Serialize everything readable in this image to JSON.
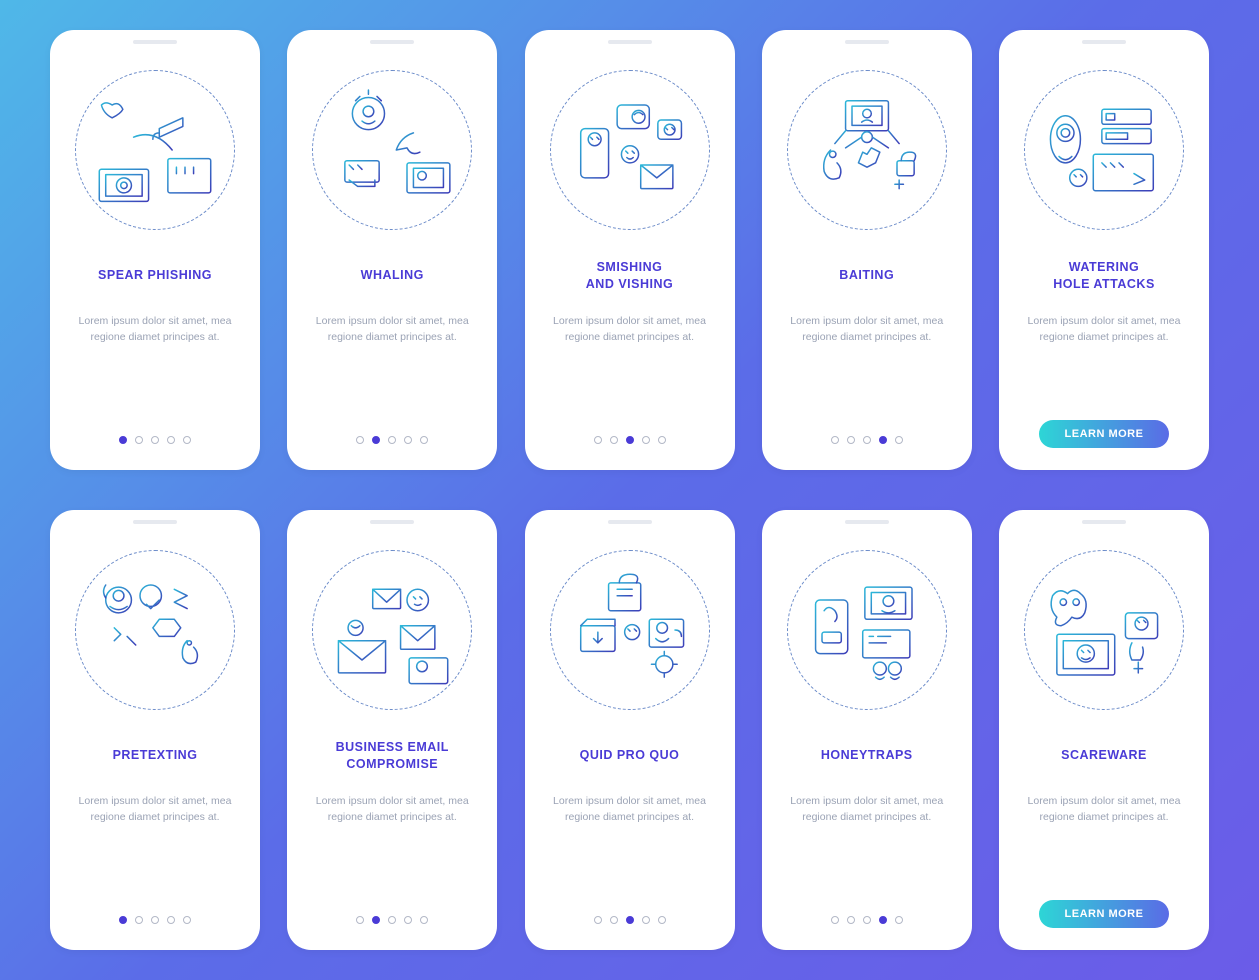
{
  "button_label": "LEARN MORE",
  "desc": "Lorem ipsum dolor sit amet, mea regione diamet principes at.",
  "cards": [
    {
      "title": "SPEAR PHISHING",
      "active": 0,
      "dots": 5,
      "icon": "spear"
    },
    {
      "title": "WHALING",
      "active": 1,
      "dots": 5,
      "icon": "whaling"
    },
    {
      "title": "SMISHING\nAND VISHING",
      "active": 2,
      "dots": 5,
      "icon": "smishing"
    },
    {
      "title": "BAITING",
      "active": 3,
      "dots": 5,
      "icon": "baiting"
    },
    {
      "title": "WATERING\nHOLE ATTACKS",
      "button": true,
      "icon": "watering"
    },
    {
      "title": "PRETEXTING",
      "active": 0,
      "dots": 5,
      "icon": "pretexting"
    },
    {
      "title": "BUSINESS EMAIL\nCOMPROMISE",
      "active": 1,
      "dots": 5,
      "icon": "bec"
    },
    {
      "title": "QUID PRO QUO",
      "active": 2,
      "dots": 5,
      "icon": "quid"
    },
    {
      "title": "HONEYTRAPS",
      "active": 3,
      "dots": 5,
      "icon": "honey"
    },
    {
      "title": "SCAREWARE",
      "button": true,
      "icon": "scare"
    }
  ],
  "icons": {
    "spear": "<rect x='18' y='78' width='46' height='30' rx='2'/><rect x='24' y='83' width='34' height='20'/><circle cx='41' cy='93' r='7'/><circle cx='41' cy='93' r='3'/><path d='M30 18 Q24 14 20 18 Q22 26 30 30 Q38 26 40 22 Q36 14 30 18'/><path d='M96 30 L74 40 L74 48 L96 38 Z M74 44 Q68 44 68 50'/><rect x='82' y='68' width='40' height='32' rx='2'/><path d='M90 76 L90 82 M98 76 L98 82 M106 76 L106 82'/><path d='M50 48 Q70 40 86 60'/>",
    "whaling": "<circle cx='48' cy='26' r='15'/><circle cx='48' cy='24' r='5'/><path d='M42 33 Q48 38 54 33'/><path d='M36 14 L40 10 M60 14 L56 10 M48 8 L48 4'/><path d='M90 44 Q78 48 74 60 L84 58 Q88 66 96 62'/><rect x='84' y='72' width='40' height='28' rx='2'/><rect x='90' y='77' width='28' height='18'/><circle cx='98' cy='84' r='4'/><rect x='26' y='70' width='32' height='20' rx='2'/><path d='M30 74 L34 78 M38 74 L42 78'/><path d='M30 88 L38 94 L54 94 L54 88'/>",
    "smishing": "<rect x='24' y='40' width='26' height='46' rx='4'/><circle cx='37' cy='50' r='6'/><path d='M33 48 L35 50 M39 48 L41 50'/><rect x='58' y='18' width='30' height='22' rx='4'/><circle cx='78' cy='29' r='6'/><path d='M74 27 Q78 23 82 27'/><rect x='96' y='32' width='22' height='18' rx='3'/><circle cx='107' cy='41' r='5'/><path d='M103 39 L105 41 M109 39 L111 41'/><rect x='80' y='74' width='30' height='22' rx='1'/><path d='M80 74 L95 86 L110 74'/><circle cx='70' cy='64' r='8'/><path d='M66 61 L68 63 M72 61 L74 63 M67 67 Q70 70 73 67'/>",
    "baiting": "<rect x='50' y='14' width='40' height='28' rx='2'/><rect x='56' y='19' width='28' height='18'/><circle cx='70' cy='26' r='4'/><path d='M65 34 Q70 30 75 34'/><path d='M50 42 L40 54 M90 42 L100 54'/><circle cx='70' cy='48' r='5'/><path d='M65 48 L50 58 M75 48 L90 58'/><path d='M36 60 Q28 68 30 80 Q34 90 44 86 Q48 78 42 72'/><circle cx='38' cy='64' r='3'/><path d='M70 64 L74 58 L82 62 L78 72 L70 76 L62 72 L66 62 Z'/><rect x='98' y='70' width='16' height='14' rx='2'/><path d='M102 70 Q102 62 110 62 Q118 62 114 70'/><path d='M96 92 L104 92 M100 88 L100 96'/>",
    "watering": "<ellipse cx='34' cy='50' rx='14' ry='22'/><circle cx='34' cy='44' r='8'/><circle cx='34' cy='44' r='4'/><path d='M28 66 Q34 72 40 66'/><rect x='68' y='22' width='46' height='14' rx='2'/><rect x='72' y='26' width='8' height='6'/><rect x='68' y='40' width='46' height='14' rx='2'/><rect x='72' y='44' width='20' height='6'/><rect x='60' y='64' width='56' height='34' rx='2'/><path d='M68 72 L72 76 M76 72 L80 76 M84 72 L88 76'/><path d='M98 82 L108 88 L98 92'/><circle cx='46' cy='86' r='8'/><path d='M42 83 L44 85 M48 83 L50 85'/>",
    "pretexting": "<circle cx='36' cy='32' r='12'/><circle cx='36' cy='28' r='5'/><path d='M28 38 Q36 44 44 38'/><path d='M24 30 Q20 24 24 18'/><circle cx='66' cy='28' r='10'/><path d='M62 36 L66 40 L74 32'/><path d='M88 22 L100 28 L88 34 L100 40'/><path d='M32 58 L38 64 L32 70 M44 66 L52 74'/><path d='M68 58 L74 50 L88 50 L94 58 L88 66 L74 66 Z'/><path d='M81 54 L81 60 M81 63 L81 64'/><path d='M100 70 Q94 76 96 86 Q100 94 108 90 Q112 82 106 76'/><circle cx='102' cy='72' r='2'/>",
    "bec": "<rect x='20' y='70' width='44' height='30' rx='1'/><path d='M20 70 L42 88 L64 70'/><circle cx='36' cy='58' r='7'/><path d='M32 56 Q36 60 40 56'/><rect x='52' y='22' width='26' height='18' rx='1'/><path d='M52 22 L65 34 L78 22'/><circle cx='94' cy='32' r='10'/><path d='M90 29 L92 31 M96 29 L98 31 M91 36 Q94 38 97 36'/><rect x='78' y='56' width='32' height='22' rx='1'/><path d='M78 56 L94 70 L110 56'/><rect x='86' y='86' width='36' height='24' rx='2'/><circle cx='98' cy='94' r='5'/><path d='M104 92 L104 98 M104 101 L104 102'/>",
    "quid": "<rect x='50' y='16' width='30' height='26' rx='2'/><path d='M60 16 Q60 8 70 8 Q80 8 76 16'/><path d='M58 22 L72 22 M58 28 L72 28'/><rect x='24' y='56' width='32' height='24' rx='2'/><path d='M24 56 L30 50 L56 50 L56 56'/><path d='M40 62 L40 72 M36 68 L40 72 L44 68'/><circle cx='72' cy='62' r='7'/><path d='M68 59 L70 61 M74 59 L76 61'/><rect x='88' y='50' width='32' height='26' rx='2'/><circle cx='100' cy='58' r='5'/><path d='M94 68 Q100 74 106 68'/><path d='M112 60 Q118 60 118 66'/><circle cx='102' cy='92' r='8'/><path d='M102 84 L102 80 M102 100 L102 104 M94 92 L90 92 M110 92 L114 92'/>",
    "honey": "<rect x='22' y='32' width='30' height='50' rx='4'/><path d='M30 42 Q34 36 40 42 Q44 48 40 52'/><rect x='28' y='62' width='18' height='10' rx='2'/><path d='M32 66 L44 66'/><rect x='68' y='20' width='44' height='30' rx='2'/><rect x='74' y='25' width='32' height='20'/><circle cx='90' cy='33' r='5'/><path d='M84 42 Q90 46 96 42'/><rect x='66' y='60' width='44' height='26' rx='2'/><path d='M72 66 L76 66 M80 66 L92 66 M72 72 L88 72'/><circle cx='82' cy='96' r='6'/><circle cx='96' cy='96' r='6'/><path d='M78 104 Q82 108 86 104 M92 104 Q96 108 100 104'/>",
    "scare": "<path d='M36 26 Q28 20 22 28 Q18 40 26 48 Q22 56 30 56 Q36 54 40 48 Q48 52 52 44 Q56 32 48 26 Q42 20 36 26'/><circle cx='32' cy='34' r='3'/><circle cx='44' cy='34' r='3'/><rect x='26' y='64' width='54' height='38' rx='2'/><rect x='32' y='70' width='42' height='26'/><circle cx='53' cy='82' r='8'/><path d='M49 79 L51 81 M55 79 L57 81 M49 86 Q53 89 57 86'/><rect x='90' y='44' width='30' height='24' rx='3'/><circle cx='105' cy='54' r='6'/><path d='M101 51 L103 53 M107 51 L109 53'/><path d='M96 72 Q92 80 96 88 L104 88 Q108 82 106 76'/><path d='M102 90 L102 100 M98 96 L106 96'/>"
  }
}
